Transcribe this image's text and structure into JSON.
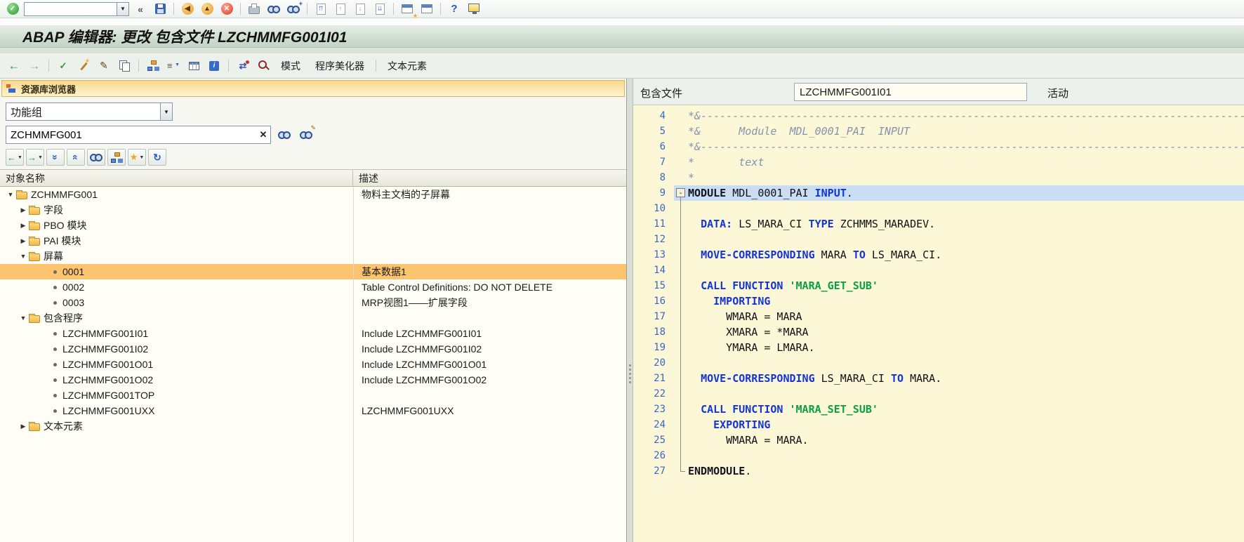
{
  "window": {
    "title": "ABAP 编辑器: 更改 包含文件 LZCHMMFG001I01"
  },
  "sysbar": {
    "command_value": ""
  },
  "apptoolbar": {
    "mode": "模式",
    "pretty_printer": "程序美化器",
    "text_elements": "文本元素"
  },
  "left": {
    "header": "资源库浏览器",
    "category": {
      "value": "功能组"
    },
    "object_name": {
      "value": "ZCHMMFG001"
    },
    "columns": {
      "object": "对象名称",
      "desc": "描述"
    },
    "tree": [
      {
        "label": "ZCHMMFG001",
        "desc": "物料主文档的子屏幕",
        "level": 0,
        "type": "folder-open",
        "selected": false
      },
      {
        "label": "字段",
        "desc": "",
        "level": 1,
        "type": "folder-closed",
        "selected": false
      },
      {
        "label": "PBO 模块",
        "desc": "",
        "level": 1,
        "type": "folder-closed",
        "selected": false
      },
      {
        "label": "PAI 模块",
        "desc": "",
        "level": 1,
        "type": "folder-closed",
        "selected": false
      },
      {
        "label": "屏幕",
        "desc": "",
        "level": 1,
        "type": "folder-open",
        "selected": false
      },
      {
        "label": "0001",
        "desc": "基本数据1",
        "level": 2,
        "type": "leaf",
        "selected": true
      },
      {
        "label": "0002",
        "desc": "Table Control Definitions: DO NOT DELETE",
        "level": 2,
        "type": "leaf",
        "selected": false
      },
      {
        "label": "0003",
        "desc": "MRP视图1——扩展字段",
        "level": 2,
        "type": "leaf",
        "selected": false
      },
      {
        "label": "包含程序",
        "desc": "",
        "level": 1,
        "type": "folder-open",
        "selected": false
      },
      {
        "label": "LZCHMMFG001I01",
        "desc": "Include LZCHMMFG001I01",
        "level": 2,
        "type": "leaf",
        "selected": false
      },
      {
        "label": "LZCHMMFG001I02",
        "desc": "Include LZCHMMFG001I02",
        "level": 2,
        "type": "leaf",
        "selected": false
      },
      {
        "label": "LZCHMMFG001O01",
        "desc": "Include LZCHMMFG001O01",
        "level": 2,
        "type": "leaf",
        "selected": false
      },
      {
        "label": "LZCHMMFG001O02",
        "desc": "Include LZCHMMFG001O02",
        "level": 2,
        "type": "leaf",
        "selected": false
      },
      {
        "label": "LZCHMMFG001TOP",
        "desc": "",
        "level": 2,
        "type": "leaf",
        "selected": false
      },
      {
        "label": "LZCHMMFG001UXX",
        "desc": "LZCHMMFG001UXX",
        "level": 2,
        "type": "leaf",
        "selected": false
      },
      {
        "label": "文本元素",
        "desc": "",
        "level": 1,
        "type": "folder-closed",
        "selected": false
      }
    ]
  },
  "right": {
    "include_label": "包含文件",
    "include_value": "LZCHMMFG001I01",
    "status": "活动",
    "code": {
      "lines": [
        {
          "n": 4,
          "fold": "",
          "sel": false,
          "seg": [
            {
              "c": "com",
              "t": "*&------------------------------------------------------------------------------------------------------------------------"
            }
          ]
        },
        {
          "n": 5,
          "fold": "",
          "sel": false,
          "seg": [
            {
              "c": "com",
              "t": "*&      Module  MDL_0001_PAI  INPUT"
            }
          ]
        },
        {
          "n": 6,
          "fold": "",
          "sel": false,
          "seg": [
            {
              "c": "com",
              "t": "*&------------------------------------------------------------------------------------------------------------------------"
            }
          ]
        },
        {
          "n": 7,
          "fold": "",
          "sel": false,
          "seg": [
            {
              "c": "com",
              "t": "*       text"
            }
          ]
        },
        {
          "n": 8,
          "fold": "",
          "sel": false,
          "seg": [
            {
              "c": "com",
              "t": "*"
            }
          ]
        },
        {
          "n": 9,
          "fold": "box",
          "sel": true,
          "seg": [
            {
              "c": "kwb",
              "t": "MODULE"
            },
            {
              "c": "id",
              "t": " MDL_0001_PAI "
            },
            {
              "c": "kw",
              "t": "INPUT"
            },
            {
              "c": "id",
              "t": "."
            }
          ]
        },
        {
          "n": 10,
          "fold": "line",
          "sel": false,
          "seg": []
        },
        {
          "n": 11,
          "fold": "line",
          "sel": false,
          "seg": [
            {
              "c": "id",
              "t": "  "
            },
            {
              "c": "kw",
              "t": "DATA:"
            },
            {
              "c": "id",
              "t": " LS_MARA_CI "
            },
            {
              "c": "kw",
              "t": "TYPE"
            },
            {
              "c": "id",
              "t": " ZCHMMS_MARADEV."
            }
          ]
        },
        {
          "n": 12,
          "fold": "line",
          "sel": false,
          "seg": []
        },
        {
          "n": 13,
          "fold": "line",
          "sel": false,
          "seg": [
            {
              "c": "id",
              "t": "  "
            },
            {
              "c": "kw",
              "t": "MOVE-CORRESPONDING"
            },
            {
              "c": "id",
              "t": " MARA "
            },
            {
              "c": "kw",
              "t": "TO"
            },
            {
              "c": "id",
              "t": " LS_MARA_CI."
            }
          ]
        },
        {
          "n": 14,
          "fold": "line",
          "sel": false,
          "seg": []
        },
        {
          "n": 15,
          "fold": "line",
          "sel": false,
          "seg": [
            {
              "c": "id",
              "t": "  "
            },
            {
              "c": "kw",
              "t": "CALL FUNCTION"
            },
            {
              "c": "id",
              "t": " "
            },
            {
              "c": "str",
              "t": "'MARA_GET_SUB'"
            }
          ]
        },
        {
          "n": 16,
          "fold": "line",
          "sel": false,
          "seg": [
            {
              "c": "id",
              "t": "    "
            },
            {
              "c": "kw",
              "t": "IMPORTING"
            }
          ]
        },
        {
          "n": 17,
          "fold": "line",
          "sel": false,
          "seg": [
            {
              "c": "id",
              "t": "      WMARA = MARA"
            }
          ]
        },
        {
          "n": 18,
          "fold": "line",
          "sel": false,
          "seg": [
            {
              "c": "id",
              "t": "      XMARA = *MARA"
            }
          ]
        },
        {
          "n": 19,
          "fold": "line",
          "sel": false,
          "seg": [
            {
              "c": "id",
              "t": "      YMARA = LMARA."
            }
          ]
        },
        {
          "n": 20,
          "fold": "line",
          "sel": false,
          "seg": []
        },
        {
          "n": 21,
          "fold": "line",
          "sel": false,
          "seg": [
            {
              "c": "id",
              "t": "  "
            },
            {
              "c": "kw",
              "t": "MOVE-CORRESPONDING"
            },
            {
              "c": "id",
              "t": " LS_MARA_CI "
            },
            {
              "c": "kw",
              "t": "TO"
            },
            {
              "c": "id",
              "t": " MARA."
            }
          ]
        },
        {
          "n": 22,
          "fold": "line",
          "sel": false,
          "seg": []
        },
        {
          "n": 23,
          "fold": "line",
          "sel": false,
          "seg": [
            {
              "c": "id",
              "t": "  "
            },
            {
              "c": "kw",
              "t": "CALL FUNCTION"
            },
            {
              "c": "id",
              "t": " "
            },
            {
              "c": "str",
              "t": "'MARA_SET_SUB'"
            }
          ]
        },
        {
          "n": 24,
          "fold": "line",
          "sel": false,
          "seg": [
            {
              "c": "id",
              "t": "    "
            },
            {
              "c": "kw",
              "t": "EXPORTING"
            }
          ]
        },
        {
          "n": 25,
          "fold": "line",
          "sel": false,
          "seg": [
            {
              "c": "id",
              "t": "      WMARA = MARA."
            }
          ]
        },
        {
          "n": 26,
          "fold": "line",
          "sel": false,
          "seg": []
        },
        {
          "n": 27,
          "fold": "end",
          "sel": false,
          "seg": [
            {
              "c": "kwb",
              "t": "ENDMODULE"
            },
            {
              "c": "id",
              "t": "."
            }
          ]
        }
      ]
    }
  },
  "colors": {
    "selected-row": "#fcc46f",
    "editor-bg": "#fcf8d7",
    "line-selected": "#c9def5",
    "keyword": "#1434d8",
    "string": "#0aa142",
    "comment": "#8492ae"
  }
}
